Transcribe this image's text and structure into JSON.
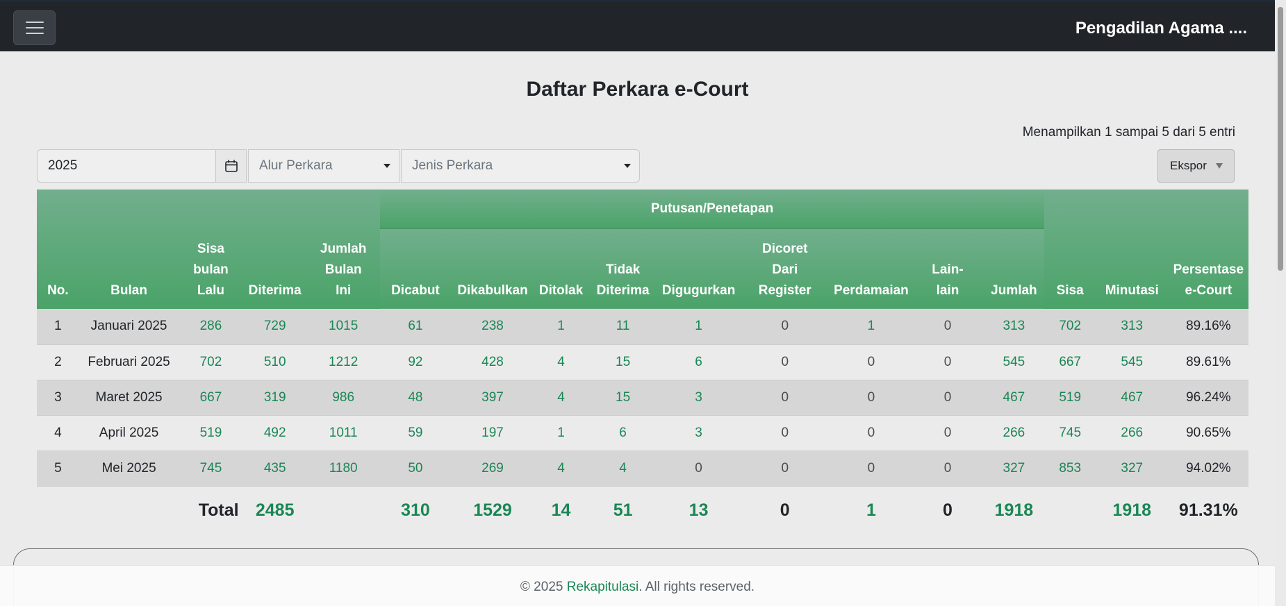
{
  "header": {
    "brand": "Pengadilan Agama ....",
    "menu_icon": "hamburger-menu-icon"
  },
  "page": {
    "title": "Daftar Perkara e-Court",
    "entries_info": "Menampilkan 1 sampai 5 dari 5 entri"
  },
  "filters": {
    "year_value": "2025",
    "calendar_icon": "calendar-icon",
    "alur_placeholder": "Alur Perkara",
    "jenis_placeholder": "Jenis Perkara"
  },
  "export": {
    "label": "Ekspor"
  },
  "table": {
    "group_header": "Putusan/Penetapan",
    "headers": {
      "no": "No.",
      "bulan": "Bulan",
      "sisa_bulan_lalu": [
        "Sisa",
        "bulan",
        "Lalu"
      ],
      "diterima": "Diterima",
      "jumlah_bulan_ini": [
        "Jumlah",
        "Bulan",
        "Ini"
      ],
      "dicabut": "Dicabut",
      "dikabulkan": "Dikabulkan",
      "ditolak": "Ditolak",
      "tidak_diterima": [
        "Tidak",
        "Diterima"
      ],
      "digugurkan": "Digugurkan",
      "dicoret": [
        "Dicoret",
        "Dari",
        "Register"
      ],
      "perdamaian": "Perdamaian",
      "lain_lain": [
        "Lain-",
        "lain"
      ],
      "jumlah": "Jumlah",
      "sisa": "Sisa",
      "minutasi": "Minutasi",
      "persentase": [
        "Persentase",
        "e-Court"
      ]
    },
    "rows": [
      [
        "1",
        "Januari 2025",
        "286",
        "729",
        "1015",
        "61",
        "238",
        "1",
        "11",
        "1",
        "0",
        "1",
        "0",
        "313",
        "702",
        "313",
        "89.16%"
      ],
      [
        "2",
        "Februari 2025",
        "702",
        "510",
        "1212",
        "92",
        "428",
        "4",
        "15",
        "6",
        "0",
        "0",
        "0",
        "545",
        "667",
        "545",
        "89.61%"
      ],
      [
        "3",
        "Maret 2025",
        "667",
        "319",
        "986",
        "48",
        "397",
        "4",
        "15",
        "3",
        "0",
        "0",
        "0",
        "467",
        "519",
        "467",
        "96.24%"
      ],
      [
        "4",
        "April 2025",
        "519",
        "492",
        "1011",
        "59",
        "197",
        "1",
        "6",
        "3",
        "0",
        "0",
        "0",
        "266",
        "745",
        "266",
        "90.65%"
      ],
      [
        "5",
        "Mei 2025",
        "745",
        "435",
        "1180",
        "50",
        "269",
        "4",
        "4",
        "0",
        "0",
        "0",
        "0",
        "327",
        "853",
        "327",
        "94.02%"
      ]
    ],
    "totals": {
      "label": "Total",
      "diterima": "2485",
      "dicabut": "310",
      "dikabulkan": "1529",
      "ditolak": "14",
      "tidak_diterima": "51",
      "digugurkan": "13",
      "dicoret": "0",
      "perdamaian": "1",
      "lain_lain": "0",
      "jumlah": "1918",
      "minutasi": "1918",
      "persentase": "91.31%"
    }
  },
  "footer": {
    "prefix": "© 2025 ",
    "link": "Rekapitulasi",
    "suffix": ". All rights reserved."
  },
  "colors": {
    "header_bg": "#212529",
    "table_header": "#4aa368",
    "value_green": "#198754"
  }
}
